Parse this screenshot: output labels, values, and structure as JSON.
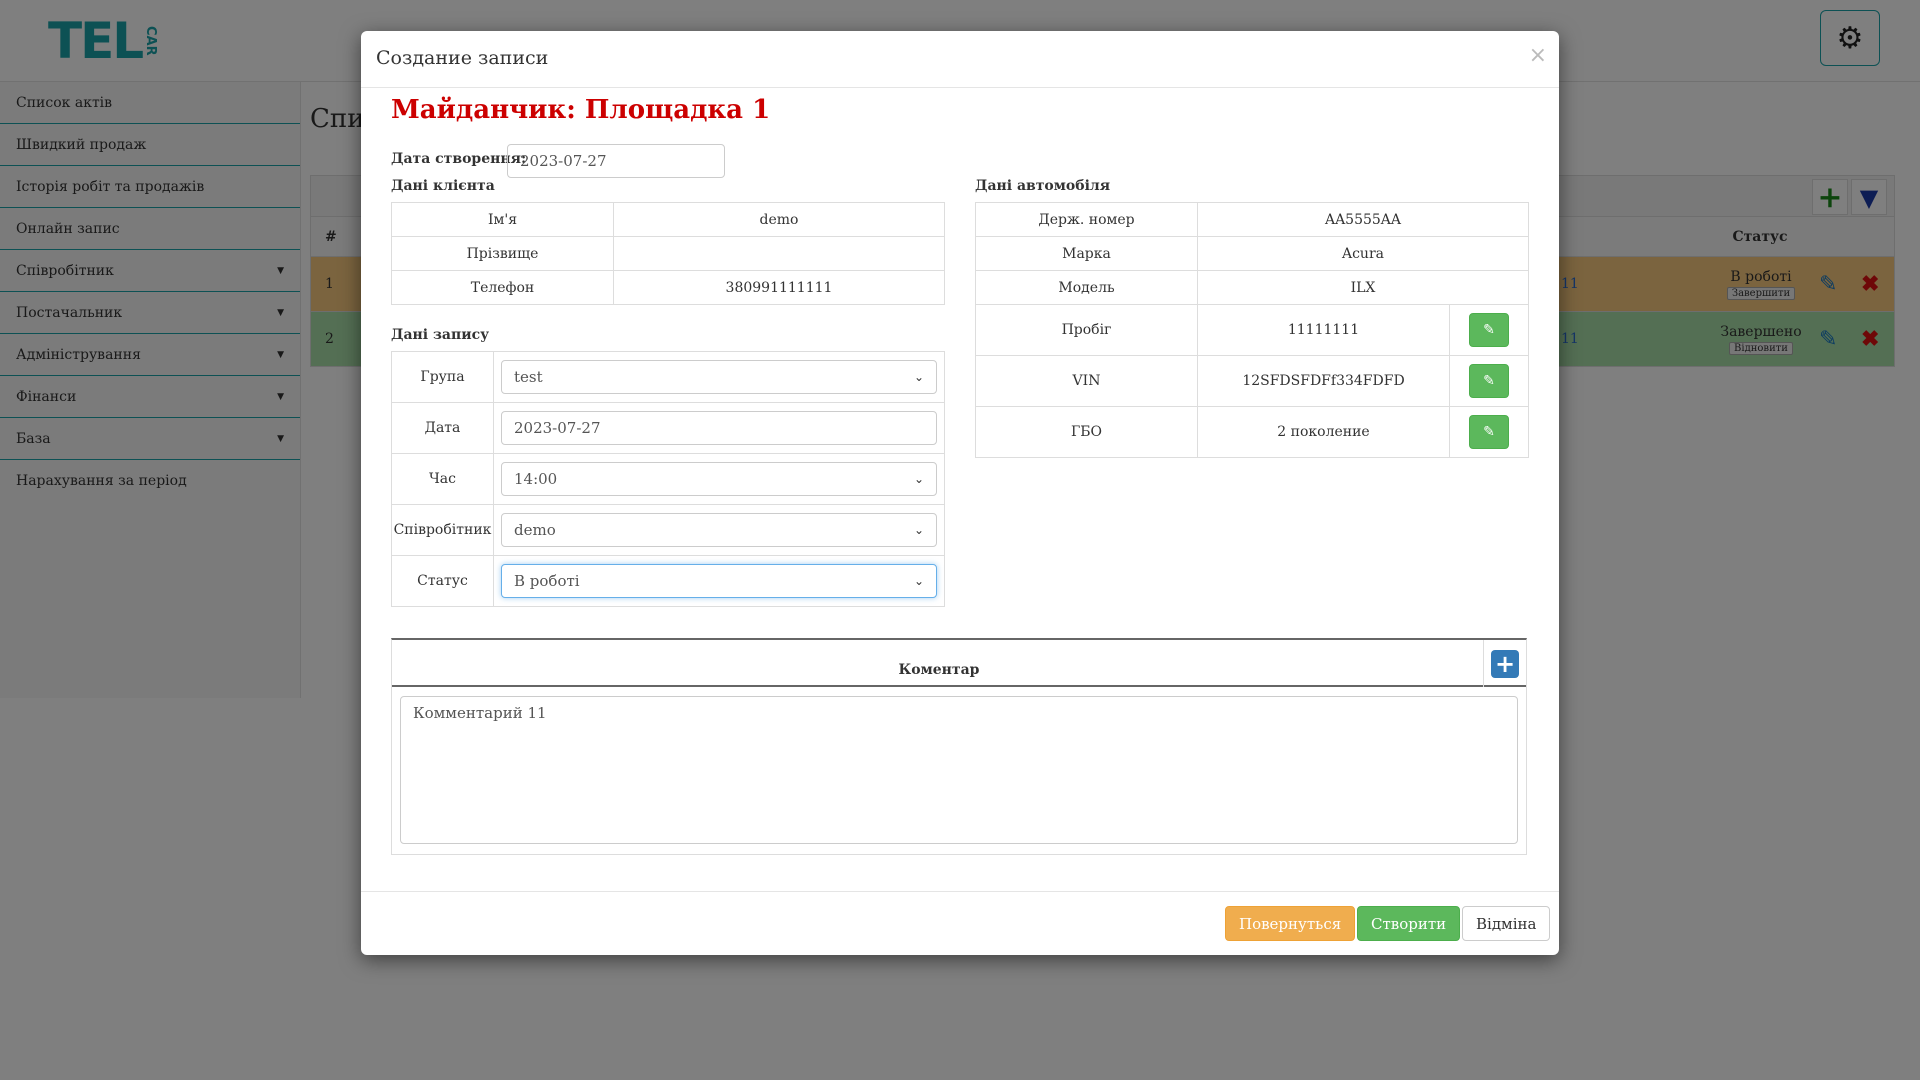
{
  "header": {
    "logo_main": "TEL",
    "logo_side": "CAR",
    "settings_icon": "gear-icon"
  },
  "sidebar": {
    "items": [
      {
        "label": "Список актів",
        "dropdown": false
      },
      {
        "label": "Швидкий продаж",
        "dropdown": false
      },
      {
        "label": "Історія робіт та продажів",
        "dropdown": false
      },
      {
        "label": "Онлайн запис",
        "dropdown": false
      },
      {
        "label": "Співробітник",
        "dropdown": true
      },
      {
        "label": "Постачальник",
        "dropdown": true
      },
      {
        "label": "Адміністрування",
        "dropdown": true
      },
      {
        "label": "Фінанси",
        "dropdown": true
      },
      {
        "label": "База",
        "dropdown": true
      },
      {
        "label": "Нарахування за період",
        "dropdown": false
      }
    ]
  },
  "background": {
    "title": "Спи",
    "table": {
      "col_num": "#",
      "col_status": "Статус",
      "rows": [
        {
          "num": "1",
          "partial": "11",
          "status": "В роботі",
          "action": "Завершити",
          "color": "#f7c97e"
        },
        {
          "num": "2",
          "partial": "11",
          "status": "Завершено",
          "action": "Відновити",
          "color": "#a9dfa9"
        }
      ]
    }
  },
  "modal": {
    "title": "Создание записи",
    "close": "×",
    "ploshchadka": "Майданчик: Площадка 1",
    "creation_date_label": "Дата створення:",
    "creation_date": "2023-07-27",
    "client": {
      "heading": "Дані клієнта",
      "rows": [
        {
          "label": "Ім'я",
          "value": "demo"
        },
        {
          "label": "Прізвище",
          "value": ""
        },
        {
          "label": "Телефон",
          "value": "380991111111"
        }
      ]
    },
    "record": {
      "heading": "Дані запису",
      "rows": [
        {
          "label": "Група",
          "value": "test",
          "type": "select"
        },
        {
          "label": "Дата",
          "value": "2023-07-27",
          "type": "input"
        },
        {
          "label": "Час",
          "value": "14:00",
          "type": "select"
        },
        {
          "label": "Співробітник",
          "value": "demo",
          "type": "select"
        },
        {
          "label": "Статус",
          "value": "В роботі",
          "type": "select"
        }
      ]
    },
    "car": {
      "heading": "Дані автомобіля",
      "rows": [
        {
          "label": "Держ. номер",
          "value": "AA5555AA",
          "editable": false
        },
        {
          "label": "Марка",
          "value": "Acura",
          "editable": false
        },
        {
          "label": "Модель",
          "value": "ILX",
          "editable": false
        },
        {
          "label": "Пробіг",
          "value": "11111111",
          "editable": true
        },
        {
          "label": "VIN",
          "value": "12SFDSFDFf334FDFD",
          "editable": true
        },
        {
          "label": "ГБО",
          "value": "2 поколение",
          "editable": true
        }
      ]
    },
    "comment": {
      "heading": "Коментар",
      "text": "Комментарий 11"
    },
    "buttons": {
      "back": "Повернуться",
      "create": "Створити",
      "cancel": "Відміна"
    }
  },
  "colors": {
    "accent": "#1aa3a8",
    "danger_title": "#cc0000",
    "success": "#5cb85c",
    "warning": "#f0ad4e",
    "primary": "#337ab7"
  }
}
